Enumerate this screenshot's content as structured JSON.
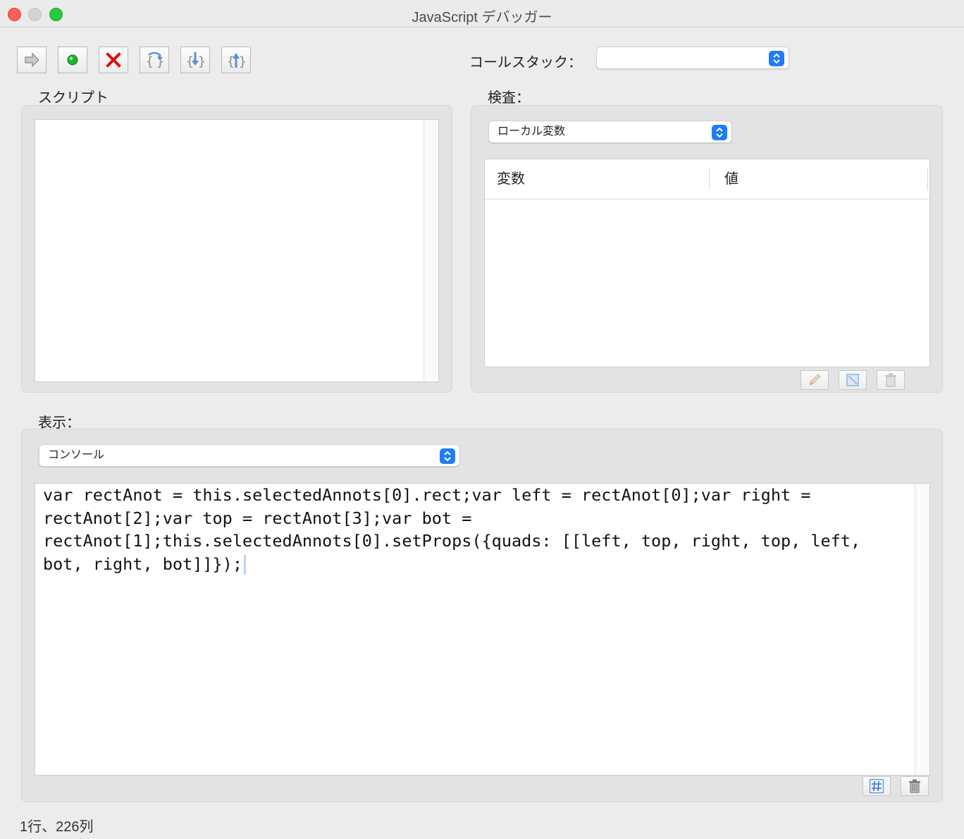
{
  "window": {
    "title": "JavaScript デバッガー"
  },
  "toolbar": {
    "buttons": [
      {
        "name": "resume-icon"
      },
      {
        "name": "run-dot-icon"
      },
      {
        "name": "stop-x-icon"
      },
      {
        "name": "step-over-icon"
      },
      {
        "name": "step-into-icon"
      },
      {
        "name": "step-out-icon"
      }
    ]
  },
  "callstack": {
    "label": "コールスタック：",
    "value": ""
  },
  "script": {
    "label": "スクリプト"
  },
  "inspect": {
    "label": "検査：",
    "selected": "ローカル変数",
    "columns": [
      "変数",
      "値"
    ]
  },
  "view": {
    "label": "表示：",
    "selected": "コンソール",
    "console_text": "var rectAnot = this.selectedAnnots[0].rect;var left = rectAnot[0];var right = rectAnot[2];var top = rectAnot[3];var bot = rectAnot[1];this.selectedAnnots[0].setProps({quads: [[left, top, right, top, left, bot, right, bot]]});"
  },
  "status": {
    "text": "1行、226列"
  },
  "colors": {
    "accent": "#1f7cf7",
    "close": "#fe5f57",
    "minimize": "#d3d3d3",
    "zoom": "#27c93f"
  }
}
